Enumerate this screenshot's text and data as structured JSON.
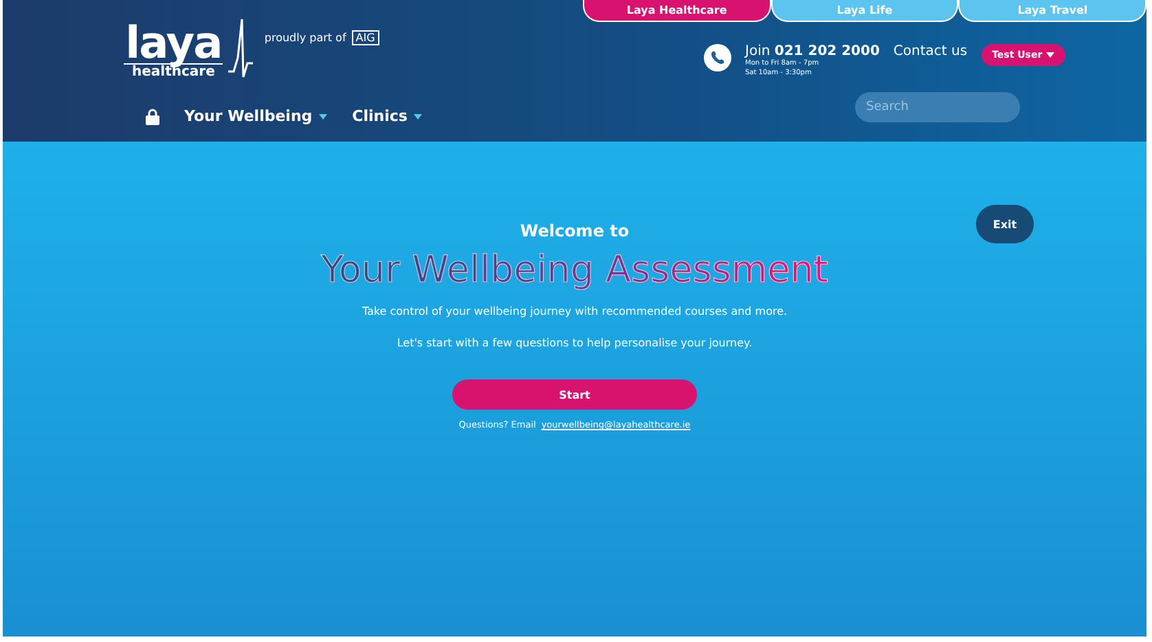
{
  "brand_tabs": [
    {
      "label": "Laya Healthcare",
      "selected": true
    },
    {
      "label": "Laya Life",
      "selected": false
    },
    {
      "label": "Laya Travel",
      "selected": false
    }
  ],
  "logo": {
    "wordmark": "laya",
    "subline": "healthcare",
    "partner_text": "proudly part of",
    "partner": "AIG"
  },
  "contact": {
    "prefix": "Join",
    "phone": "021 202 2000",
    "hours": [
      "Mon to Fri 8am - 7pm",
      "Sat 10am - 3:30pm"
    ],
    "link": "Contact us",
    "user_button": "Test User"
  },
  "nav": [
    {
      "kind": "lock"
    },
    {
      "kind": "menu",
      "label": "Your Wellbeing",
      "dropdown": true
    },
    {
      "kind": "menu",
      "label": "Clinics",
      "dropdown": true
    }
  ],
  "search": {
    "placeholder": "Search"
  },
  "main": {
    "exit": "Exit",
    "kicker": "Welcome to",
    "title": "Your Wellbeing Assessment",
    "lines": [
      "Take control of your wellbeing journey with recommended courses and more.",
      "Let's start with a few questions to help personalise your journey."
    ],
    "start": "Start",
    "question": "Questions? Email",
    "email": "yourwellbeing@layahealthcare.ie"
  }
}
